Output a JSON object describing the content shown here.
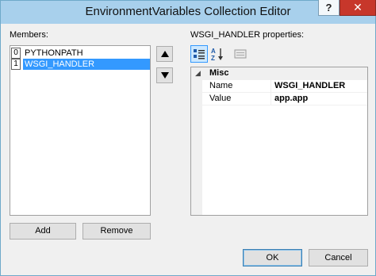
{
  "window": {
    "title": "EnvironmentVariables Collection Editor",
    "help_label": "?",
    "close_label": "✕"
  },
  "members": {
    "label": "Members:",
    "items": [
      {
        "index": "0",
        "name": "PYTHONPATH",
        "selected": false
      },
      {
        "index": "1",
        "name": "WSGI_HANDLER",
        "selected": true
      }
    ],
    "add_label": "Add",
    "remove_label": "Remove"
  },
  "properties": {
    "label": "WSGI_HANDLER properties:",
    "toolbar": [
      {
        "icon": "categorized-icon",
        "active": true
      },
      {
        "icon": "alphabetical-sort-icon",
        "active": false
      },
      {
        "icon": "property-pages-icon",
        "active": false
      }
    ],
    "category": {
      "glyph": "◢",
      "label": "Misc"
    },
    "rows": [
      {
        "name": "Name",
        "value": "WSGI_HANDLER"
      },
      {
        "name": "Value",
        "value": "app.app"
      }
    ]
  },
  "footer": {
    "ok_label": "OK",
    "cancel_label": "Cancel"
  },
  "colors": {
    "titlebar": "#a8d0ec",
    "selection": "#3399ff",
    "close": "#c7372b"
  }
}
